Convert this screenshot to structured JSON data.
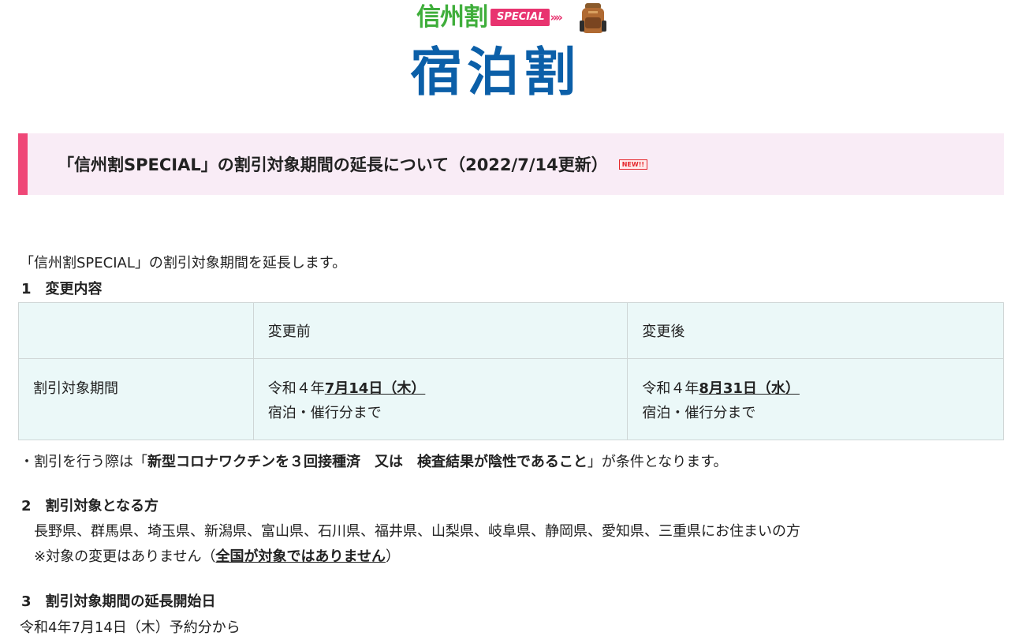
{
  "logo": {
    "brand": "信州割",
    "special": "SPECIAL",
    "chevrons": "»»",
    "main": "宿泊割"
  },
  "banner": {
    "title": "「信州割SPECIAL」の割引対象期間の延長について（2022/7/14更新）",
    "badge": "NEW!!"
  },
  "intro": "「信州割SPECIAL」の割引対象期間を延長します。",
  "section1": {
    "heading": "1　変更内容",
    "table": {
      "header": [
        "",
        "変更前",
        "変更後"
      ],
      "row_label": "割引対象期間",
      "before": {
        "prefix": "令和４年",
        "date": "7月14日（木）",
        "line2": "宿泊・催行分まで"
      },
      "after": {
        "prefix": "令和４年",
        "date": "8月31日（水）",
        "line2": "宿泊・催行分まで"
      }
    },
    "note": {
      "prefix": "・割引を行う際は「",
      "emphasis": "新型コロナワクチンを３回接種済　又は　検査結果が陰性であること",
      "suffix": "」が条件となります。"
    }
  },
  "section2": {
    "heading": "2　割引対象となる方",
    "prefectures": "長野県、群馬県、埼玉県、新潟県、富山県、石川県、福井県、山梨県、岐阜県、静岡県、愛知県、三重県にお住まいの方",
    "note_prefix": "※対象の変更はありません（",
    "note_emphasis": "全国が対象ではありません",
    "note_suffix": "）"
  },
  "section3": {
    "heading": "3　割引対象期間の延長開始日",
    "text": "令和4年7月14日（木）予約分から"
  },
  "colors": {
    "brand_green": "#3fae3b",
    "special_pink": "#e8336f",
    "main_blue": "#0b5fa8",
    "banner_bg": "#f9ecf6",
    "banner_accent": "#ef4777",
    "table_bg": "#ebf8f8"
  }
}
